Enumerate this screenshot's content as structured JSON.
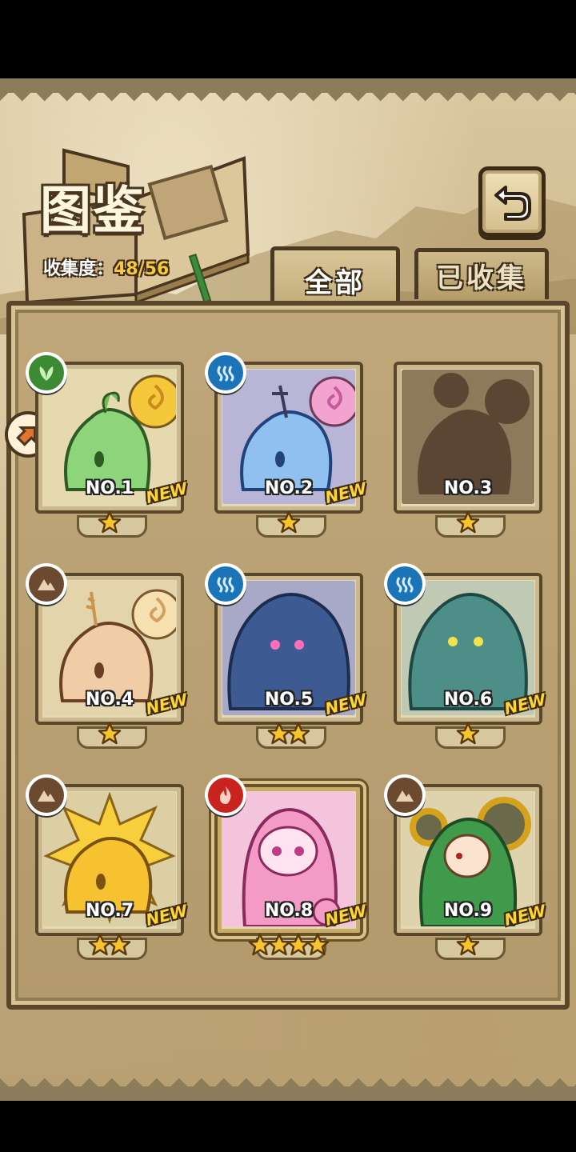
{
  "header": {
    "title": "图鉴",
    "progress_label": "收集度：",
    "progress_value": "48/56"
  },
  "tabs": [
    {
      "label": "全部",
      "active": true
    },
    {
      "label": "已收集",
      "active": false
    }
  ],
  "back_button": {
    "icon": "back-arrow-icon"
  },
  "side_badge": {
    "icon": "arrow-badge-icon"
  },
  "cards": [
    {
      "no": "NO.1",
      "new": "NEW",
      "stars": 1,
      "element": "leaf-icon",
      "collected": true
    },
    {
      "no": "NO.2",
      "new": "NEW",
      "stars": 1,
      "element": "water-icon",
      "collected": true
    },
    {
      "no": "NO.3",
      "new": "",
      "stars": 1,
      "element": "",
      "collected": false
    },
    {
      "no": "NO.4",
      "new": "NEW",
      "stars": 1,
      "element": "earth-icon",
      "collected": true
    },
    {
      "no": "NO.5",
      "new": "NEW",
      "stars": 2,
      "element": "water-icon",
      "collected": true
    },
    {
      "no": "NO.6",
      "new": "NEW",
      "stars": 1,
      "element": "water-icon",
      "collected": true
    },
    {
      "no": "NO.7",
      "new": "NEW",
      "stars": 2,
      "element": "earth-icon",
      "collected": true
    },
    {
      "no": "NO.8",
      "new": "NEW",
      "stars": 4,
      "element": "fire-icon",
      "collected": true
    },
    {
      "no": "NO.9",
      "new": "NEW",
      "stars": 1,
      "element": "earth-icon",
      "collected": true
    }
  ],
  "colors": {
    "star": "#f6c42c",
    "new_tag": "#ffd52e",
    "progress_value": "#f6c93a",
    "leaf": "#3d8a35",
    "water": "#1c74b8",
    "earth": "#6b4a30",
    "fire": "#c8231d"
  }
}
